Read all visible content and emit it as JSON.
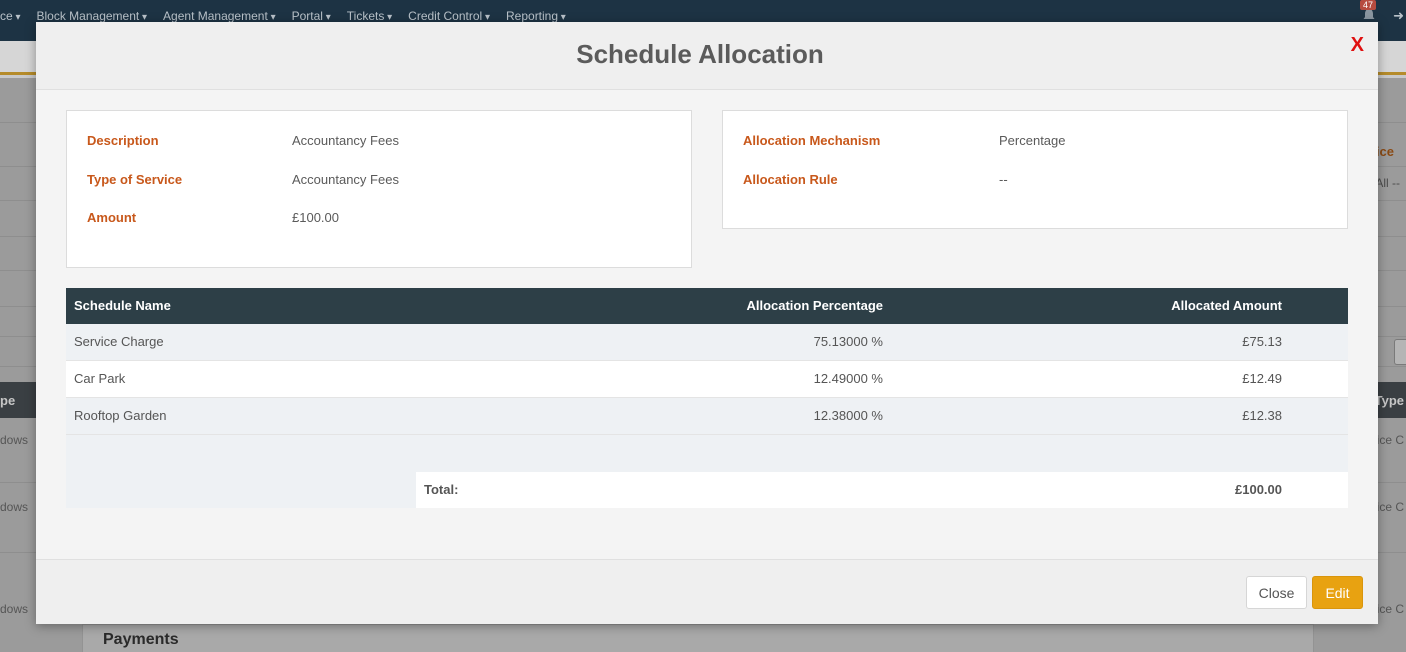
{
  "background": {
    "nav_items": [
      "ce",
      "Block Management",
      "Agent Management",
      "Portal",
      "Tickets",
      "Credit Control",
      "Reporting"
    ],
    "notification_count": "47",
    "left_column_text": [
      "pe",
      "dows",
      "dows",
      "dows"
    ],
    "right_header_text": "ice",
    "right_filter_text": "All --",
    "right_column_text": [
      "Type",
      "vice C",
      "vice C",
      "vice C"
    ],
    "payments_title": "Payments"
  },
  "modal": {
    "title": "Schedule Allocation",
    "close_x": "X",
    "details_left": [
      {
        "label": "Description",
        "value": "Accountancy Fees"
      },
      {
        "label": "Type of Service",
        "value": "Accountancy Fees"
      },
      {
        "label": "Amount",
        "value": "£100.00"
      }
    ],
    "details_right": [
      {
        "label": "Allocation Mechanism",
        "value": "Percentage"
      },
      {
        "label": "Allocation Rule",
        "value": "--"
      }
    ],
    "table": {
      "headers": [
        "Schedule Name",
        "Allocation Percentage",
        "Allocated Amount"
      ],
      "rows": [
        [
          "Service Charge",
          "75.13000 %",
          "£75.13"
        ],
        [
          "Car Park",
          "12.49000 %",
          "£12.49"
        ],
        [
          "Rooftop Garden",
          "12.38000 %",
          "£12.38"
        ]
      ],
      "total_label": "Total:",
      "total_value": "£100.00"
    },
    "footer": {
      "close_label": "Close",
      "edit_label": "Edit"
    }
  },
  "colors": {
    "accent_orange": "#c8581b",
    "table_header": "#2d3f47",
    "edit_button": "#e8a211",
    "close_x": "#e01010"
  }
}
